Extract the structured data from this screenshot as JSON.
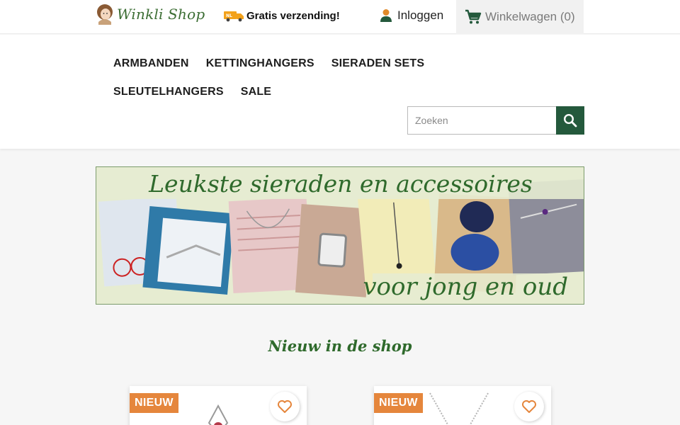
{
  "header": {
    "logo_text": "Winkli Shop",
    "promo_badge": "NL",
    "promo_text": "Gratis verzending!",
    "login_label": "Inloggen",
    "cart_label": "Winkelwagen (0)"
  },
  "menu": {
    "items": [
      "ARMBANDEN",
      "KETTINGHANGERS",
      "SIERADEN SETS",
      "SLEUTELHANGERS",
      "SALE"
    ]
  },
  "search": {
    "placeholder": "Zoeken"
  },
  "banner": {
    "title": "Leukste sieraden en accessoires",
    "subtitle": "voor jong en oud"
  },
  "section": {
    "title": "Nieuw in de shop"
  },
  "products": [
    {
      "badge": "NIEUW"
    },
    {
      "badge": "NIEUW"
    }
  ],
  "colors": {
    "brand_green": "#24593c",
    "title_green": "#2f6a2c",
    "badge_orange": "#e5863c",
    "wishlist_orange": "#e5863c"
  },
  "icons": [
    "logo-icon",
    "delivery-truck-icon",
    "user-icon",
    "shopping-cart-icon",
    "search-icon",
    "heart-icon"
  ]
}
